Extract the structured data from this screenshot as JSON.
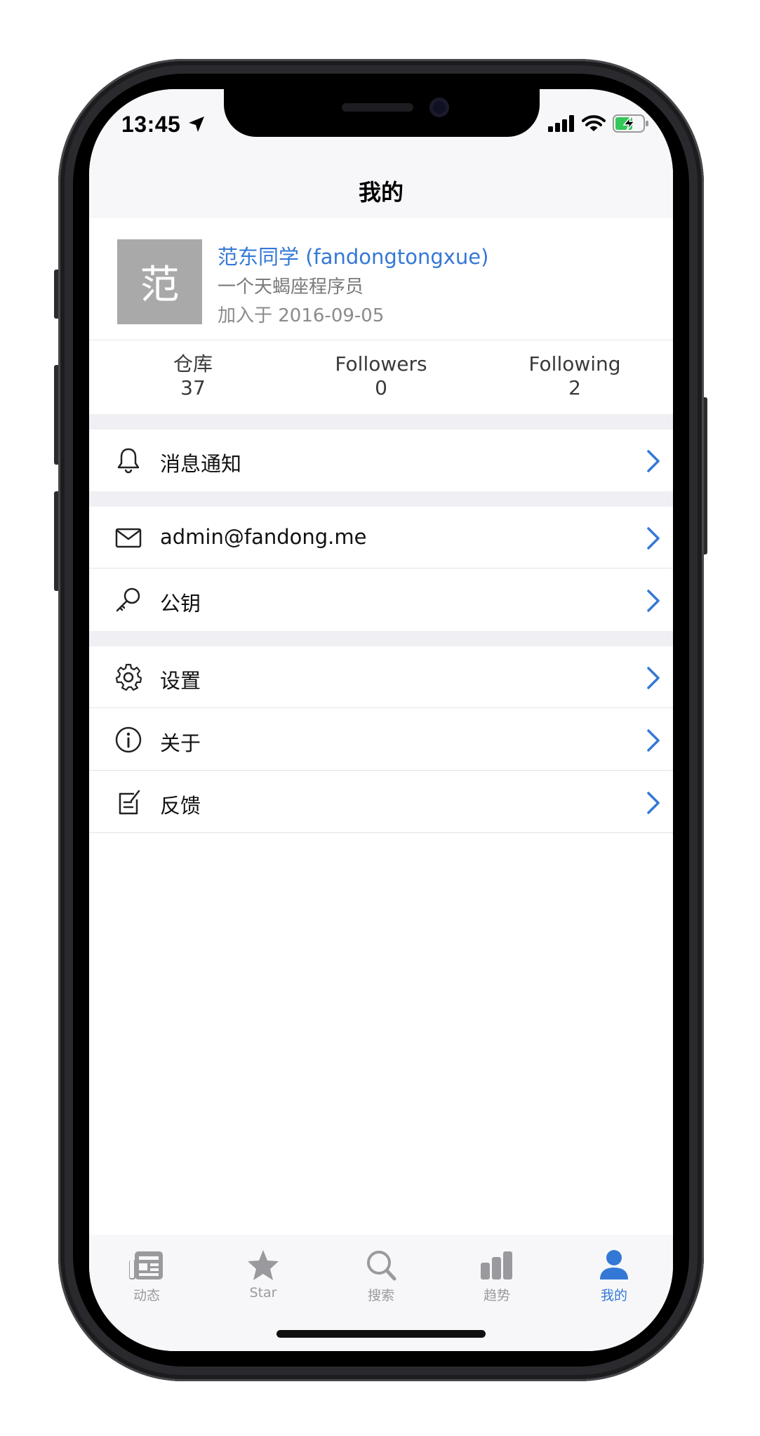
{
  "status_bar": {
    "time": "13:45"
  },
  "nav": {
    "title": "我的"
  },
  "profile": {
    "avatar_text": "范",
    "name": "范东同学 (fandongtongxue)",
    "bio": "一个天蝎座程序员",
    "joined": "加入于 2016-09-05"
  },
  "stats": [
    {
      "label": "仓库",
      "value": "37"
    },
    {
      "label": "Followers",
      "value": "0"
    },
    {
      "label": "Following",
      "value": "2"
    }
  ],
  "menu": {
    "notifications": "消息通知",
    "email": "admin@fandong.me",
    "public_key": "公钥",
    "settings": "设置",
    "about": "关于",
    "feedback": "反馈"
  },
  "tabs": [
    {
      "label": "动态",
      "icon": "newspaper-icon"
    },
    {
      "label": "Star",
      "icon": "star-icon"
    },
    {
      "label": "搜索",
      "icon": "search-icon"
    },
    {
      "label": "趋势",
      "icon": "chart-icon"
    },
    {
      "label": "我的",
      "icon": "person-icon"
    }
  ],
  "colors": {
    "accent": "#3478d6",
    "tab_inactive": "#9a9a9e",
    "avatar_bg": "#a9a9a9"
  }
}
